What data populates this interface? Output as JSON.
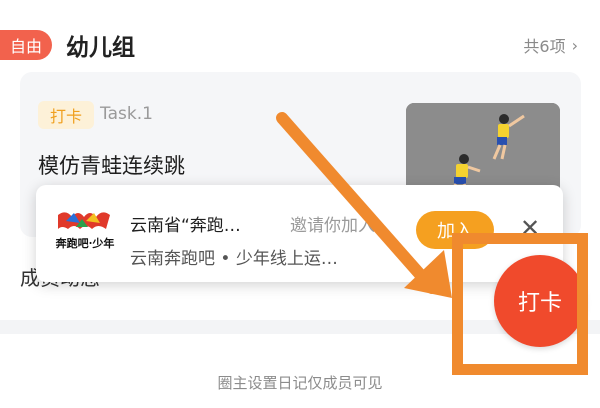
{
  "header": {
    "badge": "自由",
    "title": "幼儿组",
    "count": "共6项"
  },
  "task": {
    "tag": "打卡",
    "number": "Task.1",
    "title": "模仿青蛙连续跳"
  },
  "behind_text": "成员动态",
  "popup": {
    "name": "云南省“奔跑…",
    "invite": "邀请你加入",
    "subtitle": "云南奔跑吧 • 少年线上运…",
    "join_label": "加入",
    "close_icon": "close-icon",
    "logo_text": "奔跑吧·少年"
  },
  "fab_label": "打卡",
  "footer_note": "圈主设置日记仅成员可见",
  "colors": {
    "accent_red": "#f04a2c",
    "annotation_orange": "#f08a2e",
    "tag_orange": "#f0a020"
  }
}
